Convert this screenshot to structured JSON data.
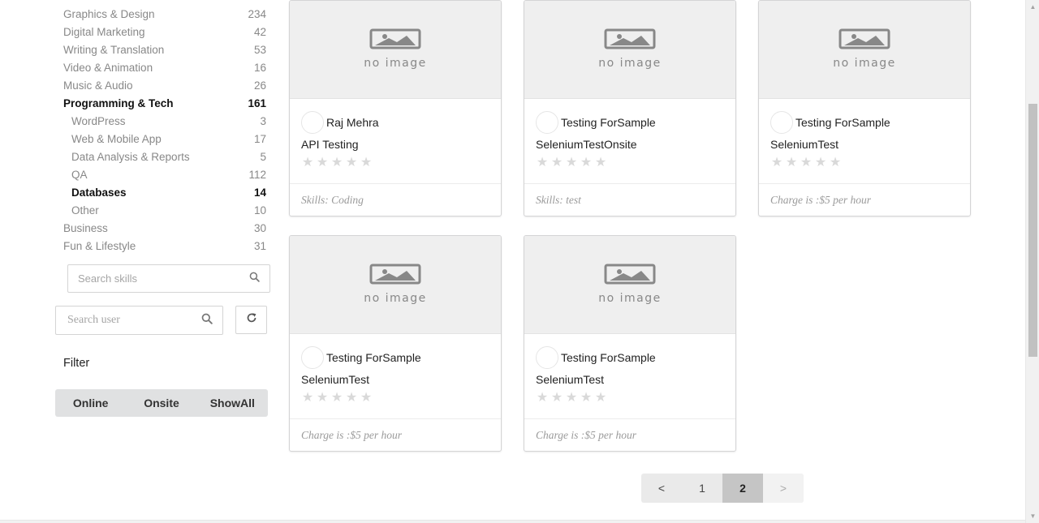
{
  "categories": [
    {
      "label": "Graphics & Design",
      "count": "234"
    },
    {
      "label": "Digital Marketing",
      "count": "42"
    },
    {
      "label": "Writing & Translation",
      "count": "53"
    },
    {
      "label": "Video & Animation",
      "count": "16"
    },
    {
      "label": "Music & Audio",
      "count": "26"
    },
    {
      "label": "Programming & Tech",
      "count": "161"
    },
    {
      "label": "WordPress",
      "count": "3"
    },
    {
      "label": "Web & Mobile App",
      "count": "17"
    },
    {
      "label": "Data Analysis & Reports",
      "count": "5"
    },
    {
      "label": "QA",
      "count": "112"
    },
    {
      "label": "Databases",
      "count": "14"
    },
    {
      "label": "Other",
      "count": "10"
    },
    {
      "label": "Business",
      "count": "30"
    },
    {
      "label": "Fun & Lifestyle",
      "count": "31"
    }
  ],
  "search": {
    "skills_placeholder": "Search skills",
    "user_placeholder": "Search user"
  },
  "filter": {
    "label": "Filter",
    "options": [
      "Online",
      "Onsite",
      "ShowAll"
    ]
  },
  "cards": [
    {
      "user": "Raj Mehra",
      "title": "API Testing",
      "footer": "Skills: Coding",
      "rating": 0
    },
    {
      "user": "Testing ForSample",
      "title": "SeleniumTestOnsite",
      "footer": "Skills: test",
      "rating": 0
    },
    {
      "user": "Testing ForSample",
      "title": "SeleniumTest",
      "footer": "Charge is :$5 per hour",
      "rating": 0
    },
    {
      "user": "Testing ForSample",
      "title": "SeleniumTest",
      "footer": "Charge is :$5 per hour",
      "rating": 0
    },
    {
      "user": "Testing ForSample",
      "title": "SeleniumTest",
      "footer": "Charge is :$5 per hour",
      "rating": 0
    }
  ],
  "placeholder_image": {
    "line1": "no image"
  },
  "pagination": {
    "prev": "<",
    "pages": [
      "1",
      "2"
    ],
    "current": "2",
    "next": ">"
  },
  "icons": {
    "search": "search-icon",
    "refresh": "refresh-icon",
    "star": "star-icon",
    "image": "image-placeholder-icon"
  },
  "colors": {
    "star_empty": "#d9d9d9",
    "page_active": "#c5c5c5",
    "filter_bg": "#e0e1e2"
  }
}
